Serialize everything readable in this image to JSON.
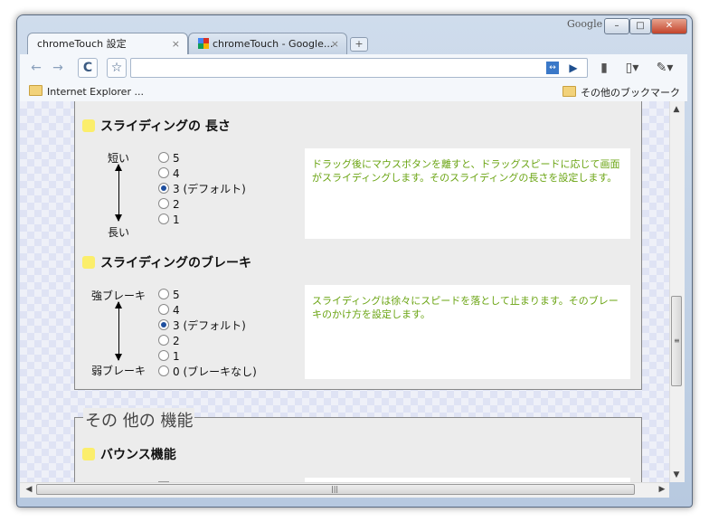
{
  "window": {
    "brand": "Google",
    "minimize": "–",
    "maximize": "□",
    "close": "✕"
  },
  "tabs": [
    {
      "label": "chromeTouch 設定",
      "close": "×"
    },
    {
      "label": "chromeTouch - Google...",
      "close": "×"
    }
  ],
  "newtab": "+",
  "toolbar": {
    "back": "←",
    "forward": "→",
    "reload": "C",
    "star": "☆",
    "url": "",
    "go": "▶",
    "page_menu": "▾",
    "wrench": "▾"
  },
  "bookmarks": {
    "left": "Internet Explorer ...",
    "right": "その他のブックマーク"
  },
  "sliding_length": {
    "title": "スライディングの 長さ",
    "top_label": "短い",
    "bottom_label": "長い",
    "options": [
      "5",
      "4",
      "3 (デフォルト)",
      "2",
      "1"
    ],
    "selected": "3 (デフォルト)",
    "description": "ドラッグ後にマウスボタンを離すと、ドラッグスピードに応じて画面がスライディングします。そのスライディングの長さを設定します。"
  },
  "sliding_brake": {
    "title": "スライディングのブレーキ",
    "top_label": "強ブレーキ",
    "bottom_label": "弱ブレーキ",
    "options": [
      "5",
      "4",
      "3 (デフォルト)",
      "2",
      "1",
      "0 (ブレーキなし)"
    ],
    "selected": "3 (デフォルト)",
    "description": "スライディングは徐々にスピードを落として止まります。そのブレーキのかけ方を設定します。"
  },
  "other_features": {
    "legend": "その 他の 機能",
    "bounce_title": "バウンス機能"
  },
  "colors": {
    "accent_square": "#fbee6b",
    "description_text": "#6aa412",
    "selected_radio": "#1d4e9e"
  }
}
